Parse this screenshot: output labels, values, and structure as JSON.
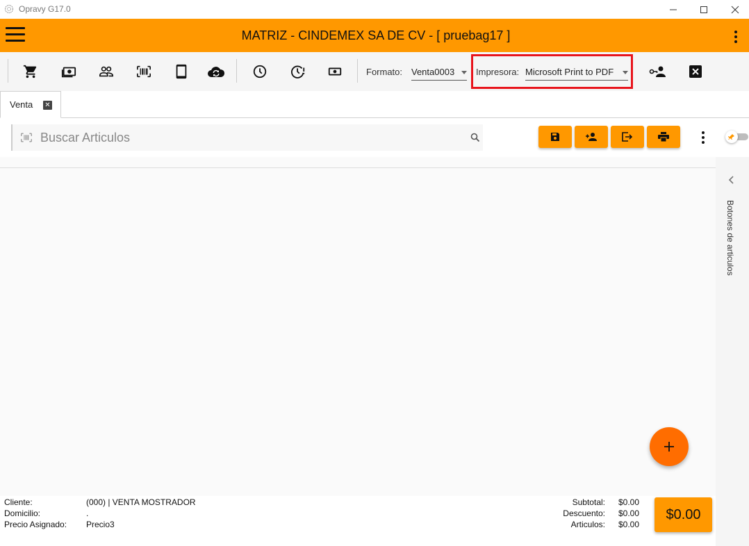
{
  "window": {
    "app_title": "Opravy G17.0"
  },
  "header": {
    "title": "MATRIZ - CINDEMEX SA DE CV - [ pruebag17 ]"
  },
  "toolbar": {
    "icons": [
      "cart-icon",
      "cash-icon",
      "people-icon",
      "barcode-icon",
      "tablet-icon",
      "cloud-sync-icon",
      "clock-icon",
      "clock-alert-icon",
      "money-icon",
      "user-key-icon",
      "close-box-icon"
    ],
    "formato_label": "Formato:",
    "formato_value": "Venta0003",
    "impresora_label": "Impresora:",
    "impresora_value": "Microsoft Print to PDF",
    "highlight_color": "#e8141c"
  },
  "tabs": [
    {
      "label": "Venta",
      "close": "✕"
    }
  ],
  "search": {
    "placeholder": "Buscar Articulos"
  },
  "side_panel": {
    "label": "Botones de articulos"
  },
  "footer": {
    "cliente_label": "Cliente:",
    "cliente_value": "(000) | VENTA MOSTRADOR",
    "domicilio_label": "Domicilio:",
    "domicilio_value": ".",
    "precio_label": "Precio Asignado:",
    "precio_value": "Precio3",
    "subtotal_label": "Subtotal:",
    "subtotal_value": "$0.00",
    "descuento_label": "Descuento:",
    "descuento_value": "$0.00",
    "articulos_label": "Articulos:",
    "articulos_value": "$0.00",
    "total": "$0.00"
  },
  "colors": {
    "accent": "#FF9800",
    "fab": "#FF6D00"
  }
}
